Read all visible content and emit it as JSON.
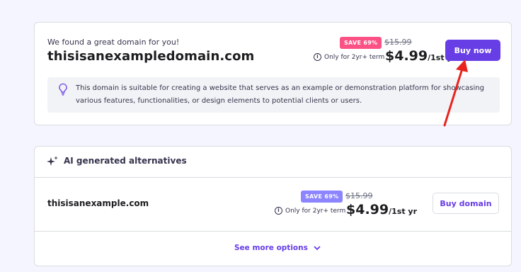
{
  "main_offer": {
    "intro_text": "We found a great domain for you!",
    "domain_name": "thisisanexampledomain.com",
    "save_badge": "SAVE 69%",
    "old_price": "$15.99",
    "term_note": "Only for 2yr+ term",
    "price": "$4.99",
    "price_unit": "/1st yr",
    "buy_button_label": "Buy now",
    "description": "This domain is suitable for creating a website that serves as an example or demonstration platform for showcasing various features, functionalities, or design elements to potential clients or users."
  },
  "alternatives": {
    "title": "AI generated alternatives",
    "items": [
      {
        "domain_name": "thisisanexample.com",
        "save_badge": "SAVE 69%",
        "old_price": "$15.99",
        "term_note": "Only for 2yr+ term",
        "price": "$4.99",
        "price_unit": "/1st yr",
        "buy_button_label": "Buy domain"
      }
    ],
    "see_more_label": "See more options"
  },
  "colors": {
    "accent": "#673de6",
    "badge_pink": "#fc5185",
    "badge_purple": "#8c85ff",
    "annotation_arrow": "#e8231e"
  },
  "icons": [
    "info-icon",
    "lightbulb-icon",
    "sparkle-icon",
    "chevron-down-icon",
    "annotation-arrow"
  ]
}
